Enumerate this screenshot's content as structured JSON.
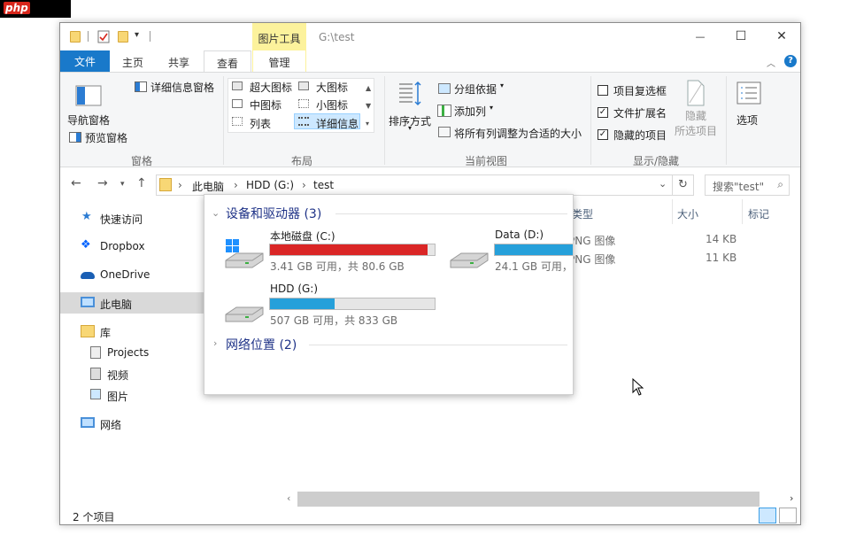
{
  "watermark": "php",
  "window": {
    "context_tab": "图片工具",
    "title": "G:\\test",
    "controls": {
      "minimize": "—",
      "maximize": "☐",
      "close": "✕"
    }
  },
  "ribbon_tabs": {
    "file": "文件",
    "home": "主页",
    "share": "共享",
    "view": "查看",
    "manage": "管理",
    "help": "?"
  },
  "ribbon": {
    "panes": {
      "nav_pane": "导航窗格",
      "preview_pane": "预览窗格",
      "details_pane": "详细信息窗格",
      "label": "窗格"
    },
    "layout": {
      "extra_large": "超大图标",
      "large": "大图标",
      "medium": "中图标",
      "small": "小图标",
      "list": "列表",
      "details": "详细信息",
      "label": "布局"
    },
    "current_view": {
      "sort_by": "排序方式",
      "group_by": "分组依据",
      "add_columns": "添加列",
      "size_all": "将所有列调整为合适的大小",
      "label": "当前视图"
    },
    "show_hide": {
      "item_checkboxes": "项目复选框",
      "item_checkboxes_checked": false,
      "file_extensions": "文件扩展名",
      "file_extensions_checked": true,
      "hidden_items": "隐藏的项目",
      "hidden_items_checked": true,
      "hide": "隐藏",
      "hide_selected": "所选项目",
      "label": "显示/隐藏"
    },
    "options": "选项"
  },
  "address": {
    "crumbs": [
      "此电脑",
      "HDD (G:)",
      "test"
    ],
    "search_placeholder": "搜索\"test\""
  },
  "nav": [
    {
      "label": "快速访问",
      "icon": "star-icon"
    },
    {
      "label": "Dropbox",
      "icon": "dropbox-icon"
    },
    {
      "label": "OneDrive",
      "icon": "onedrive-icon"
    },
    {
      "label": "此电脑",
      "icon": "computer-icon"
    },
    {
      "label": "库",
      "icon": "library-icon"
    },
    {
      "label": "Projects",
      "icon": "projects-icon"
    },
    {
      "label": "视频",
      "icon": "video-icon"
    },
    {
      "label": "图片",
      "icon": "picture-icon"
    },
    {
      "label": "网络",
      "icon": "network-icon"
    }
  ],
  "columns": {
    "type": "类型",
    "size": "大小",
    "tags": "标记"
  },
  "files": [
    {
      "type": "PNG 图像",
      "size": "14 KB"
    },
    {
      "type": "PNG 图像",
      "size": "11 KB"
    }
  ],
  "status": {
    "count": "2 个项目"
  },
  "popup": {
    "devices_heading": "设备和驱动器 (3)",
    "network_heading": "网络位置 (2)",
    "drives": [
      {
        "name": "本地磁盘 (C:)",
        "info": "3.41 GB 可用，共 80.6 GB",
        "used_fraction": 0.958,
        "bar_color": "#da2626"
      },
      {
        "name": "Data (D:)",
        "info": "24.1 GB 可用，共",
        "used_fraction": 0.9,
        "bar_color": "#26a0da"
      },
      {
        "name": "HDD (G:)",
        "info": "507 GB 可用，共 833 GB",
        "used_fraction": 0.391,
        "bar_color": "#26a0da"
      }
    ]
  }
}
